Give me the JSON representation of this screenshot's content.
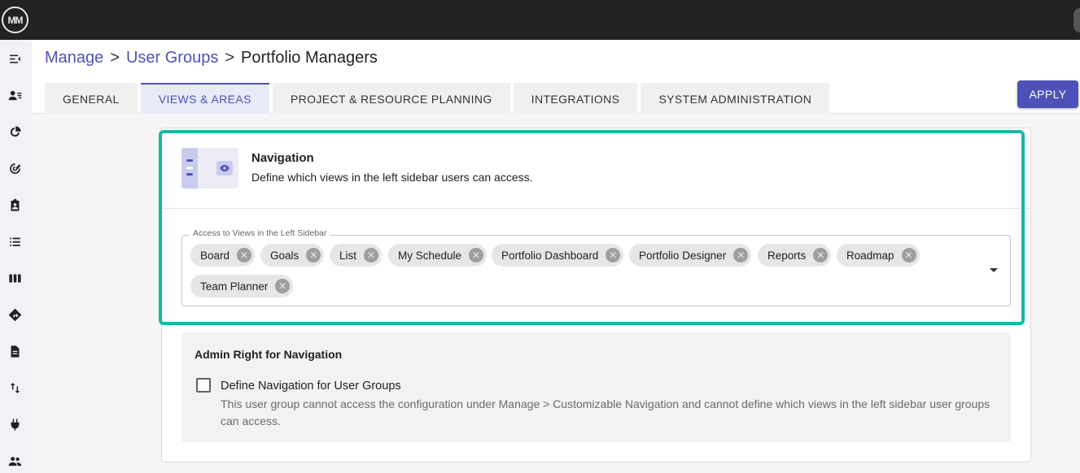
{
  "app": {
    "logo_text": "MM"
  },
  "sidebar": {
    "icons": [
      "menu-collapse-icon",
      "user-list-icon",
      "pie-chart-icon",
      "goal-target-icon",
      "clipboard-user-icon",
      "list-icon",
      "board-columns-icon",
      "roadmap-sign-icon",
      "document-icon",
      "swap-arrows-icon",
      "plug-icon",
      "people-icon"
    ]
  },
  "breadcrumb": {
    "items": [
      "Manage",
      "User Groups"
    ],
    "separator": ">",
    "current": "Portfolio Managers"
  },
  "tabs": [
    {
      "label": "GENERAL",
      "active": false
    },
    {
      "label": "VIEWS & AREAS",
      "active": true
    },
    {
      "label": "PROJECT & RESOURCE PLANNING",
      "active": false
    },
    {
      "label": "INTEGRATIONS",
      "active": false
    },
    {
      "label": "SYSTEM ADMINISTRATION",
      "active": false
    }
  ],
  "apply_label": "APPLY",
  "navigation": {
    "title": "Navigation",
    "description": "Define which views in the left sidebar users can access.",
    "field_label": "Access to Views in the Left Sidebar",
    "chips": [
      "Board",
      "Goals",
      "List",
      "My Schedule",
      "Portfolio Dashboard",
      "Portfolio Designer",
      "Reports",
      "Roadmap",
      "Team Planner"
    ]
  },
  "admin": {
    "title": "Admin Right for Navigation",
    "checkbox_label": "Define Navigation for User Groups",
    "checkbox_checked": false,
    "checkbox_description": "This user group cannot access the configuration under Manage > Customizable Navigation and cannot define which views in the left sidebar user groups can access."
  },
  "colors": {
    "accent": "#4e52b8",
    "highlight": "#14b8a6",
    "topbar": "#222222"
  }
}
